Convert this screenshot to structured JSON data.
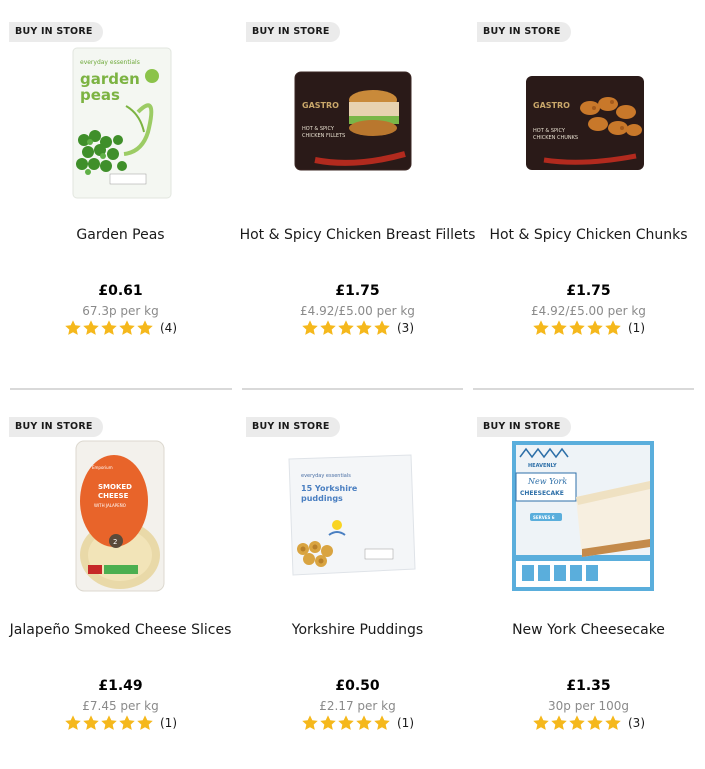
{
  "colors": {
    "star": "#f5b81c",
    "badge_bg": "#ebebeb",
    "divider": "#d9d9d9",
    "unit_text": "#8a8a8a"
  },
  "products": [
    {
      "badge": "BUY IN STORE",
      "name": "Garden Peas",
      "price": "£0.61",
      "unit_price": "67.3p per kg",
      "rating": 5,
      "review_count": "(4)",
      "image_icon": "garden-peas-bag-image"
    },
    {
      "badge": "BUY IN STORE",
      "name": "Hot & Spicy Chicken Breast Fillets",
      "price": "£1.75",
      "unit_price": "£4.92/£5.00 per kg",
      "rating": 5,
      "review_count": "(3)",
      "image_icon": "chicken-fillets-pack-image"
    },
    {
      "badge": "BUY IN STORE",
      "name": "Hot & Spicy Chicken Chunks",
      "price": "£1.75",
      "unit_price": "£4.92/£5.00 per kg",
      "rating": 5,
      "review_count": "(1)",
      "image_icon": "chicken-chunks-pack-image"
    },
    {
      "badge": "BUY IN STORE",
      "name": "Jalapeño Smoked Cheese Slices",
      "price": "£1.49",
      "unit_price": "£7.45 per kg",
      "rating": 5,
      "review_count": "(1)",
      "image_icon": "cheese-slices-pack-image"
    },
    {
      "badge": "BUY IN STORE",
      "name": "Yorkshire Puddings",
      "price": "£0.50",
      "unit_price": "£2.17 per kg",
      "rating": 5,
      "review_count": "(1)",
      "image_icon": "yorkshire-puddings-bag-image"
    },
    {
      "badge": "BUY IN STORE",
      "name": "New York Cheesecake",
      "price": "£1.35",
      "unit_price": "30p per 100g",
      "rating": 5,
      "review_count": "(3)",
      "image_icon": "cheesecake-box-image"
    }
  ],
  "packaging_text": {
    "peas_brand": "everyday essentials",
    "peas_title_1": "garden",
    "peas_title_2": "peas",
    "gastro_1": "GASTRO",
    "gastro_fillets_1": "HOT & SPICY",
    "gastro_fillets_2": "CHICKEN FILLETS",
    "gastro_chunks_1": "HOT & SPICY",
    "gastro_chunks_2": "CHICKEN CHUNKS",
    "cheese_brand": "Emporium",
    "cheese_1": "SMOKED",
    "cheese_2": "CHEESE",
    "cheese_3": "WITH JALAPEÑO",
    "yorkshire_brand": "everyday essentials",
    "yorkshire_1": "15 Yorkshire",
    "yorkshire_2": "puddings",
    "cake_brand": "HEAVENLY",
    "cake_1": "New York",
    "cake_2": "CHEESECAKE",
    "cake_3": "SERVES 6"
  }
}
